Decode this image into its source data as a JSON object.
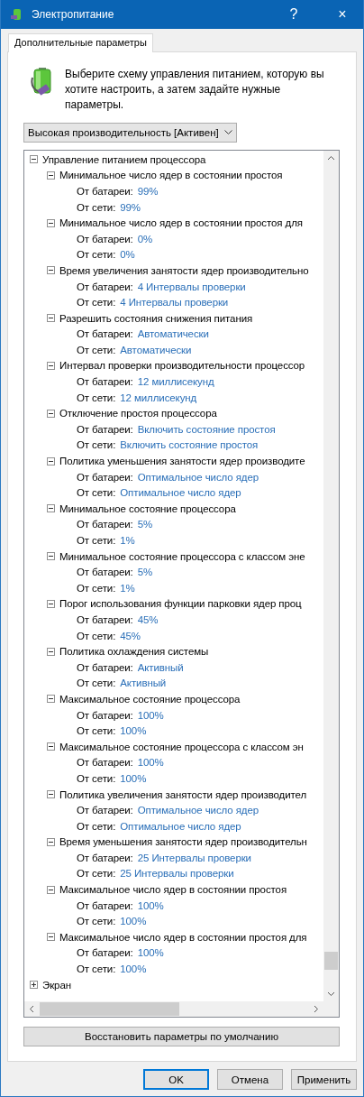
{
  "window": {
    "title": "Электропитание",
    "help": "?",
    "close": "×"
  },
  "tabs": [
    {
      "label": "Дополнительные параметры",
      "selected": true
    }
  ],
  "intro": "Выберите схему управления питанием, которую вы хотите настроить, а затем задайте нужные параметры.",
  "plan_dropdown": {
    "value": "Высокая производительность [Активен]"
  },
  "tree": [
    {
      "label": "Управление питанием процессора",
      "expanded": true,
      "children": [
        {
          "label": "Минимальное число ядер в состоянии простоя",
          "expanded": true,
          "children": [
            {
              "label": "От батареи:",
              "value": "99%"
            },
            {
              "label": "От сети:",
              "value": "99%"
            }
          ]
        },
        {
          "label": "Минимальное число ядер в состоянии простоя для",
          "expanded": true,
          "children": [
            {
              "label": "От батареи:",
              "value": "0%"
            },
            {
              "label": "От сети:",
              "value": "0%"
            }
          ]
        },
        {
          "label": "Время увеличения занятости ядер производительно",
          "expanded": true,
          "children": [
            {
              "label": "От батареи:",
              "value": "4 Интервалы проверки"
            },
            {
              "label": "От сети:",
              "value": "4 Интервалы проверки"
            }
          ]
        },
        {
          "label": "Разрешить состояния снижения питания",
          "expanded": true,
          "children": [
            {
              "label": "От батареи:",
              "value": "Автоматически"
            },
            {
              "label": "От сети:",
              "value": "Автоматически"
            }
          ]
        },
        {
          "label": "Интервал проверки производительности процессор",
          "expanded": true,
          "children": [
            {
              "label": "От батареи:",
              "value": "12 миллисекунд"
            },
            {
              "label": "От сети:",
              "value": "12 миллисекунд"
            }
          ]
        },
        {
          "label": "Отключение простоя процессора",
          "expanded": true,
          "children": [
            {
              "label": "От батареи:",
              "value": "Включить состояние простоя"
            },
            {
              "label": "От сети:",
              "value": "Включить состояние простоя"
            }
          ]
        },
        {
          "label": "Политика уменьшения занятости ядер производите",
          "expanded": true,
          "children": [
            {
              "label": "От батареи:",
              "value": "Оптимальное число ядер"
            },
            {
              "label": "От сети:",
              "value": "Оптимальное число ядер"
            }
          ]
        },
        {
          "label": "Минимальное состояние процессора",
          "expanded": true,
          "children": [
            {
              "label": "От батареи:",
              "value": "5%"
            },
            {
              "label": "От сети:",
              "value": "1%"
            }
          ]
        },
        {
          "label": "Минимальное состояние процессора с классом эне",
          "expanded": true,
          "children": [
            {
              "label": "От батареи:",
              "value": "5%"
            },
            {
              "label": "От сети:",
              "value": "1%"
            }
          ]
        },
        {
          "label": "Порог использования функции парковки ядер проц",
          "expanded": true,
          "children": [
            {
              "label": "От батареи:",
              "value": "45%"
            },
            {
              "label": "От сети:",
              "value": "45%"
            }
          ]
        },
        {
          "label": "Политика охлаждения системы",
          "expanded": true,
          "children": [
            {
              "label": "От батареи:",
              "value": "Активный"
            },
            {
              "label": "От сети:",
              "value": "Активный"
            }
          ]
        },
        {
          "label": "Максимальное состояние процессора",
          "expanded": true,
          "children": [
            {
              "label": "От батареи:",
              "value": "100%"
            },
            {
              "label": "От сети:",
              "value": "100%"
            }
          ]
        },
        {
          "label": "Максимальное состояние процессора с классом эн",
          "expanded": true,
          "children": [
            {
              "label": "От батареи:",
              "value": "100%"
            },
            {
              "label": "От сети:",
              "value": "100%"
            }
          ]
        },
        {
          "label": "Политика увеличения занятости ядер производител",
          "expanded": true,
          "children": [
            {
              "label": "От батареи:",
              "value": "Оптимальное число ядер"
            },
            {
              "label": "От сети:",
              "value": "Оптимальное число ядер"
            }
          ]
        },
        {
          "label": "Время уменьшения занятости ядер производительн",
          "expanded": true,
          "children": [
            {
              "label": "От батареи:",
              "value": "25 Интервалы проверки"
            },
            {
              "label": "От сети:",
              "value": "25 Интервалы проверки"
            }
          ]
        },
        {
          "label": "Максимальное число ядер в состоянии простоя",
          "expanded": true,
          "children": [
            {
              "label": "От батареи:",
              "value": "100%"
            },
            {
              "label": "От сети:",
              "value": "100%"
            }
          ]
        },
        {
          "label": "Максимальное число ядер в состоянии простоя для",
          "expanded": true,
          "children": [
            {
              "label": "От батареи:",
              "value": "100%"
            },
            {
              "label": "От сети:",
              "value": "100%"
            }
          ]
        }
      ]
    },
    {
      "label": "Экран",
      "expanded": false
    }
  ],
  "restore_button": "Восстановить параметры по умолчанию",
  "footer_buttons": [
    {
      "label": "OK",
      "default": true
    },
    {
      "label": "Отмена",
      "default": false
    },
    {
      "label": "Применить",
      "default": false
    }
  ]
}
